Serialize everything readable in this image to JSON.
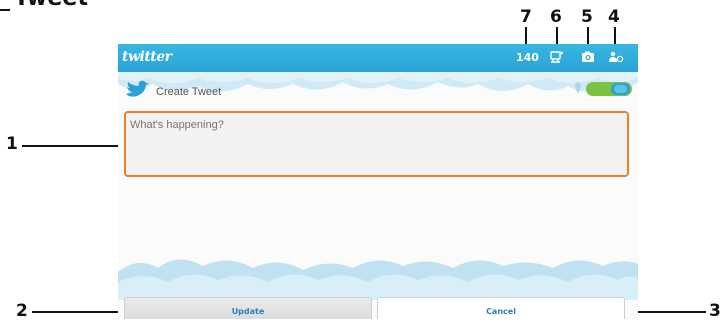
{
  "heading": {
    "text": "Tweet"
  },
  "callouts": [
    "7",
    "6",
    "5",
    "4",
    "1",
    "2",
    "3"
  ],
  "app": {
    "logo": "twitter",
    "char_count": "140",
    "compose_title": "Create Tweet",
    "compose_placeholder": "What's happening?",
    "update_label": "Update",
    "cancel_label": "Cancel"
  },
  "icons": [
    "bird-icon",
    "attach-icon",
    "camera-icon",
    "account-icon",
    "location-icon",
    "toggle-switch"
  ],
  "colors": {
    "bar": "#2aa3d4",
    "compose_border": "#e9822e",
    "button_text": "#2a7fbf",
    "toggle_green": "#7bc142"
  }
}
